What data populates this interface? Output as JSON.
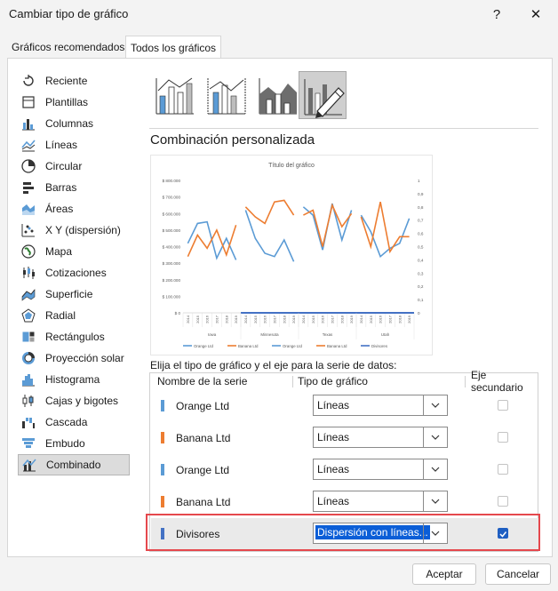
{
  "window": {
    "title": "Cambiar tipo de gráfico",
    "help": "?",
    "close": "✕"
  },
  "tabs": [
    {
      "label": "Gráficos recomendados",
      "active": false
    },
    {
      "label": "Todos los gráficos",
      "active": true
    }
  ],
  "chart_types": [
    {
      "label": "Reciente",
      "icon": "recent-icon"
    },
    {
      "label": "Plantillas",
      "icon": "templates-icon"
    },
    {
      "label": "Columnas",
      "icon": "column-chart-icon"
    },
    {
      "label": "Líneas",
      "icon": "line-chart-icon"
    },
    {
      "label": "Circular",
      "icon": "pie-chart-icon"
    },
    {
      "label": "Barras",
      "icon": "bar-chart-icon"
    },
    {
      "label": "Áreas",
      "icon": "area-chart-icon"
    },
    {
      "label": "X Y (dispersión)",
      "icon": "scatter-chart-icon"
    },
    {
      "label": "Mapa",
      "icon": "map-chart-icon"
    },
    {
      "label": "Cotizaciones",
      "icon": "stock-chart-icon"
    },
    {
      "label": "Superficie",
      "icon": "surface-chart-icon"
    },
    {
      "label": "Radial",
      "icon": "radar-chart-icon"
    },
    {
      "label": "Rectángulos",
      "icon": "treemap-chart-icon"
    },
    {
      "label": "Proyección solar",
      "icon": "sunburst-chart-icon"
    },
    {
      "label": "Histograma",
      "icon": "histogram-chart-icon"
    },
    {
      "label": "Cajas y bigotes",
      "icon": "box-whisker-chart-icon"
    },
    {
      "label": "Cascada",
      "icon": "waterfall-chart-icon"
    },
    {
      "label": "Embudo",
      "icon": "funnel-chart-icon"
    },
    {
      "label": "Combinado",
      "icon": "combo-chart-icon",
      "selected": true
    }
  ],
  "subtype_title": "Combinación personalizada",
  "preview_chart": {
    "title": "Título del gráfico",
    "y_left_ticks": [
      "$ 800.000",
      "$ 700.000",
      "$ 600.000",
      "$ 500.000",
      "$ 400.000",
      "$ 300.000",
      "$ 200.000",
      "$ 100.000",
      "$ 0"
    ],
    "y_right_ticks": [
      "1",
      "0,9",
      "0,8",
      "0,7",
      "0,6",
      "0,5",
      "0,4",
      "0,3",
      "0,2",
      "0,1",
      "0"
    ],
    "years": [
      "2014",
      "2015",
      "2016",
      "2017",
      "2018",
      "2019"
    ],
    "groups": [
      "Iowa",
      "Minnesota",
      "Texas",
      "Utah"
    ],
    "legend": [
      "Orange Ltd",
      "Banana Ltd",
      "Orange Ltd",
      "Banana Ltd",
      "Divisores"
    ],
    "colors": {
      "blue": "#5b9bd5",
      "orange": "#ed7d31",
      "divider": "#4472c4"
    }
  },
  "chart_data": {
    "type": "line",
    "title": "Título del gráfico",
    "groups": [
      "Iowa",
      "Minnesota",
      "Texas",
      "Utah"
    ],
    "categories": [
      "2014",
      "2015",
      "2016",
      "2017",
      "2018",
      "2019"
    ],
    "series": [
      {
        "name": "Orange Ltd",
        "axis": "primary",
        "values": [
          [
            420000,
            540000,
            550000,
            330000,
            450000,
            320000
          ],
          [
            620000,
            450000,
            360000,
            340000,
            440000,
            310000
          ],
          [
            640000,
            590000,
            380000,
            660000,
            440000,
            620000
          ],
          [
            590000,
            490000,
            340000,
            390000,
            420000,
            570000
          ]
        ]
      },
      {
        "name": "Banana Ltd",
        "axis": "primary",
        "values": [
          [
            340000,
            470000,
            390000,
            500000,
            350000,
            530000
          ],
          [
            640000,
            580000,
            540000,
            670000,
            680000,
            590000
          ],
          [
            590000,
            620000,
            400000,
            650000,
            520000,
            600000
          ],
          [
            580000,
            400000,
            670000,
            370000,
            460000,
            460000
          ]
        ]
      }
    ],
    "divisores": {
      "type": "scatter-line",
      "axis": "secondary",
      "y": 0
    },
    "ylim_primary": [
      0,
      800000
    ],
    "ylim_secondary": [
      0,
      1
    ]
  },
  "series_prompt": "Elija el tipo de gráfico y el eje para la serie de datos:",
  "series_headers": {
    "name": "Nombre de la serie",
    "type": "Tipo de gráfico",
    "secondary": "Eje secundario"
  },
  "series_rows": [
    {
      "name": "Orange Ltd",
      "color": "#5b9bd5",
      "type": "Líneas",
      "secondary": false
    },
    {
      "name": "Banana Ltd",
      "color": "#ed7d31",
      "type": "Líneas",
      "secondary": false
    },
    {
      "name": "Orange Ltd",
      "color": "#5b9bd5",
      "type": "Líneas",
      "secondary": false
    },
    {
      "name": "Banana Ltd",
      "color": "#ed7d31",
      "type": "Líneas",
      "secondary": false
    },
    {
      "name": "Divisores",
      "color": "#4472c4",
      "type": "Dispersión con líneas...",
      "secondary": true
    }
  ],
  "buttons": {
    "ok": "Aceptar",
    "cancel": "Cancelar"
  }
}
